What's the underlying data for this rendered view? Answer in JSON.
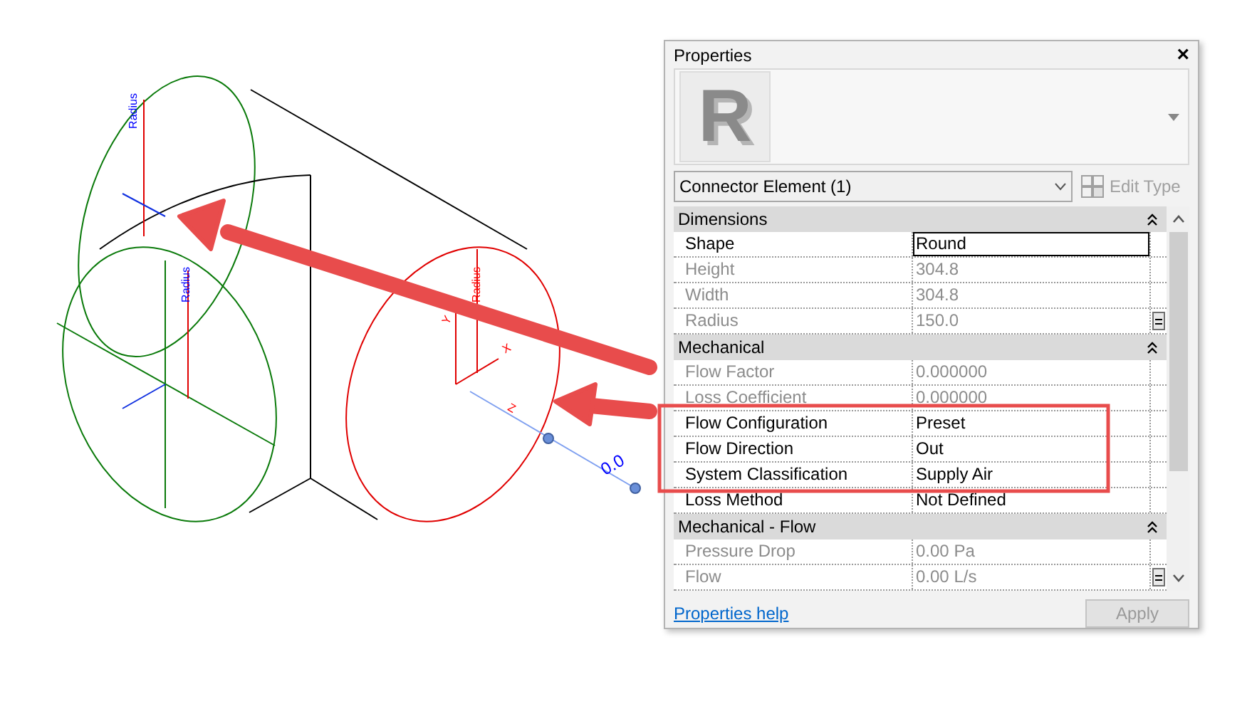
{
  "canvas": {
    "labels": [
      {
        "text": "Radius",
        "color": "#0000ff"
      },
      {
        "text": "Radius",
        "color": "#0000ff"
      },
      {
        "text": "Radius",
        "color": "#ff0000"
      },
      {
        "text": "Y",
        "color": "#ff0000"
      },
      {
        "text": "X",
        "color": "#ff0000"
      },
      {
        "text": "Z",
        "color": "#ff0000"
      },
      {
        "text": "0.0",
        "color": "#0000ff"
      }
    ]
  },
  "properties": {
    "title": "Properties",
    "close": "×",
    "preview_glyph": "R",
    "type_selector": {
      "value": "Connector Element (1)"
    },
    "edit_type": {
      "label": "Edit Type",
      "disabled": true
    },
    "rows": [
      {
        "kind": "group",
        "label": "Dimensions",
        "expanded": true
      },
      {
        "kind": "property",
        "label": "Shape",
        "value": "Round",
        "disabled": false,
        "selected": true,
        "row_button": false
      },
      {
        "kind": "property",
        "label": "Height",
        "value": "304.8",
        "disabled": true,
        "selected": false,
        "row_button": false
      },
      {
        "kind": "property",
        "label": "Width",
        "value": "304.8",
        "disabled": true,
        "selected": false,
        "row_button": false
      },
      {
        "kind": "property",
        "label": "Radius",
        "value": "150.0",
        "disabled": true,
        "selected": false,
        "row_button": true
      },
      {
        "kind": "group",
        "label": "Mechanical",
        "expanded": true
      },
      {
        "kind": "property",
        "label": "Flow Factor",
        "value": "0.000000",
        "disabled": true,
        "selected": false,
        "row_button": false
      },
      {
        "kind": "property",
        "label": "Loss Coefficient",
        "value": "0.000000",
        "disabled": true,
        "selected": false,
        "row_button": false
      },
      {
        "kind": "property",
        "label": "Flow Configuration",
        "value": "Preset",
        "disabled": false,
        "selected": false,
        "row_button": false
      },
      {
        "kind": "property",
        "label": "Flow Direction",
        "value": "Out",
        "disabled": false,
        "selected": false,
        "row_button": false
      },
      {
        "kind": "property",
        "label": "System Classification",
        "value": "Supply Air",
        "disabled": false,
        "selected": false,
        "row_button": false
      },
      {
        "kind": "property",
        "label": "Loss Method",
        "value": "Not Defined",
        "disabled": false,
        "selected": false,
        "row_button": false
      },
      {
        "kind": "group",
        "label": "Mechanical - Flow",
        "expanded": true
      },
      {
        "kind": "property",
        "label": "Pressure Drop",
        "value": "0.00 Pa",
        "disabled": true,
        "selected": false,
        "row_button": false
      },
      {
        "kind": "property",
        "label": "Flow",
        "value": "0.00 L/s",
        "disabled": true,
        "selected": false,
        "row_button": true
      }
    ],
    "help_link": "Properties help",
    "apply": {
      "label": "Apply",
      "disabled": true
    }
  }
}
